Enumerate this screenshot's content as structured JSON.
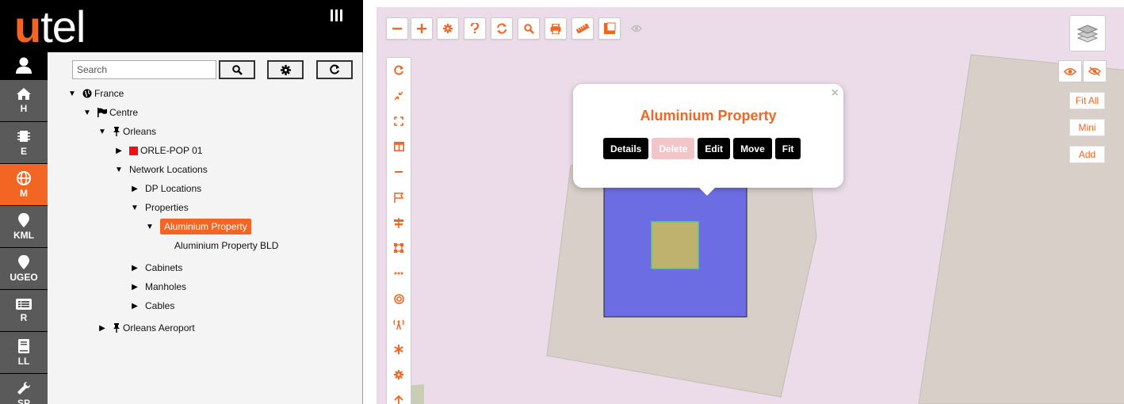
{
  "brand": {
    "logo_u": "u",
    "logo_rest": "tel"
  },
  "nav": {
    "items": [
      {
        "id": "home",
        "label": "H",
        "icon": "home-icon"
      },
      {
        "id": "equipment",
        "label": "E",
        "icon": "chip-icon"
      },
      {
        "id": "map",
        "label": "M",
        "icon": "globe-icon",
        "active": true
      },
      {
        "id": "kml",
        "label": "KML",
        "icon": "map-pin-icon"
      },
      {
        "id": "ugeo",
        "label": "UGEO",
        "icon": "map-pin-icon"
      },
      {
        "id": "reports",
        "label": "R",
        "icon": "list-icon"
      },
      {
        "id": "ll",
        "label": "LL",
        "icon": "book-icon"
      },
      {
        "id": "sp",
        "label": "SP",
        "icon": "wrench-icon"
      }
    ]
  },
  "tree": {
    "search_placeholder": "Search",
    "nodes": [
      {
        "label": "France",
        "icon": "globe-icon",
        "toggle": "▼"
      },
      {
        "label": "Centre",
        "icon": "flag-icon",
        "toggle": "▼"
      },
      {
        "label": "Orleans",
        "icon": "pushpin-icon",
        "toggle": "▼"
      },
      {
        "label": "ORLE-POP 01",
        "icon": "red-square-icon",
        "toggle": "▶"
      },
      {
        "label": "Network Locations",
        "toggle": "▼"
      },
      {
        "label": "DP Locations",
        "toggle": "▶"
      },
      {
        "label": "Properties",
        "toggle": "▼"
      },
      {
        "label": "Aluminium Property",
        "toggle": "▼",
        "selected": true
      },
      {
        "label": "Aluminium Property BLD",
        "toggle": ""
      },
      {
        "label": "Cabinets",
        "toggle": "▶"
      },
      {
        "label": "Manholes",
        "toggle": "▶"
      },
      {
        "label": "Cables",
        "toggle": "▶"
      },
      {
        "label": "Orleans Aeroport",
        "icon": "pushpin-icon",
        "toggle": "▶"
      }
    ]
  },
  "map": {
    "popup": {
      "title": "Aluminium Property",
      "close": "×",
      "actions": [
        "Details",
        "Delete",
        "Edit",
        "Move",
        "Fit"
      ],
      "disabled": [
        "Delete"
      ]
    },
    "right_buttons": {
      "fit_all": "Fit All",
      "mini": "Mini",
      "add": "Add"
    }
  },
  "colors": {
    "accent": "#f26522",
    "map_bg": "#ecdcea",
    "building": "#d7cfc8",
    "property_fill": "#6d6de3",
    "inner_fill": "#bfb26e"
  }
}
